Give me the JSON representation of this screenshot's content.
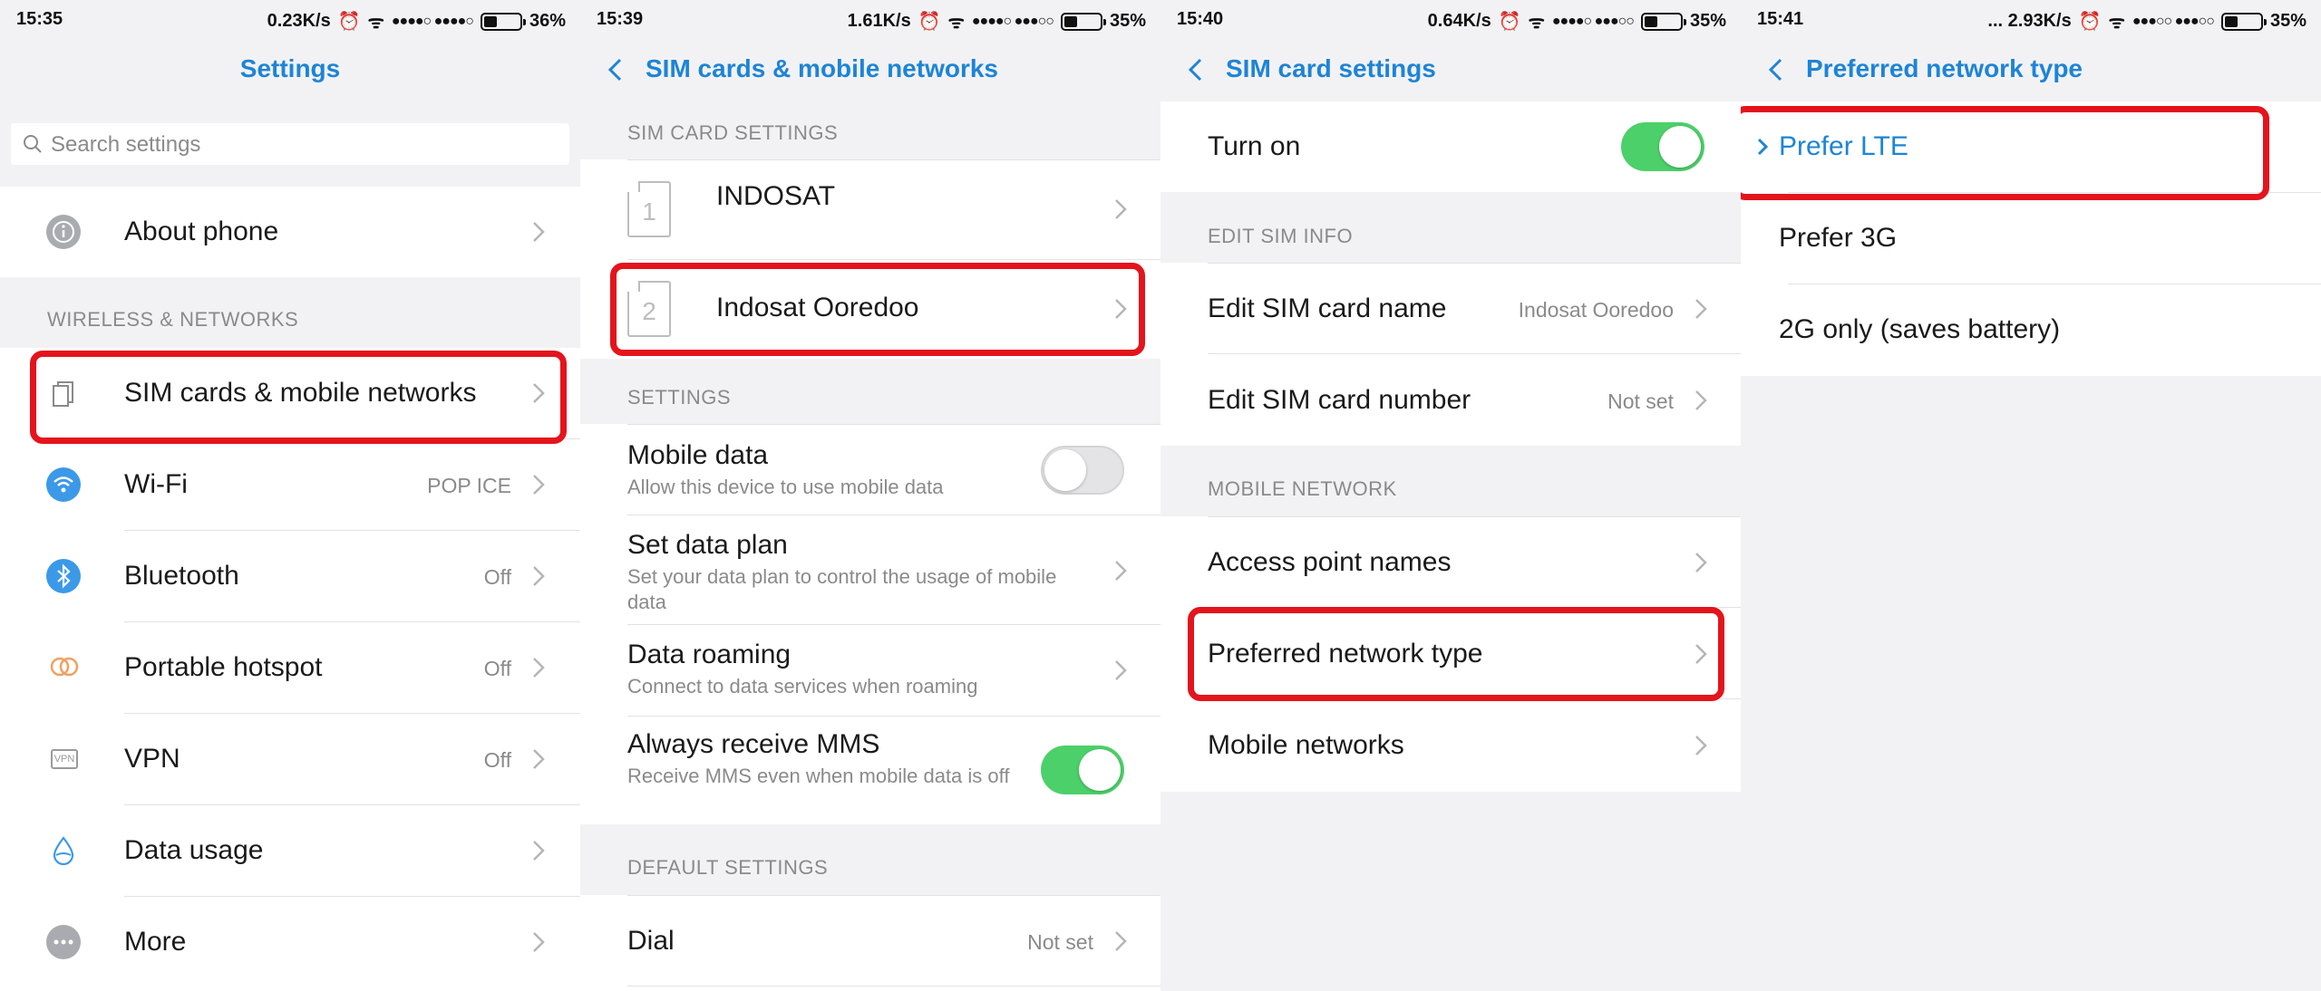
{
  "panel1": {
    "status": {
      "time": "15:35",
      "speed": "0.23K/s",
      "battery": "36%",
      "battery_level": 0.36
    },
    "title": "Settings",
    "search_placeholder": "Search settings",
    "about_label": "About phone",
    "section_wireless": "WIRELESS & NETWORKS",
    "items": [
      {
        "label": "SIM cards & mobile networks",
        "value": ""
      },
      {
        "label": "Wi-Fi",
        "value": "POP ICE"
      },
      {
        "label": "Bluetooth",
        "value": "Off"
      },
      {
        "label": "Portable hotspot",
        "value": "Off"
      },
      {
        "label": "VPN",
        "value": "Off"
      },
      {
        "label": "Data usage",
        "value": ""
      },
      {
        "label": "More",
        "value": ""
      }
    ],
    "vpn_icon_text": "VPN"
  },
  "panel2": {
    "status": {
      "time": "15:39",
      "speed": "1.61K/s",
      "battery": "35%",
      "battery_level": 0.35
    },
    "title": "SIM cards & mobile networks",
    "section_sim": "SIM CARD SETTINGS",
    "sim1": {
      "slot": "1",
      "name": "INDOSAT"
    },
    "sim2": {
      "slot": "2",
      "name": "Indosat Ooredoo"
    },
    "section_settings": "SETTINGS",
    "mobile_data": {
      "label": "Mobile data",
      "sub": "Allow this device to use mobile data",
      "on": false
    },
    "data_plan": {
      "label": "Set data plan",
      "sub": "Set your data plan to control the usage of mobile data"
    },
    "roaming": {
      "label": "Data roaming",
      "sub": "Connect to data services when roaming"
    },
    "mms": {
      "label": "Always receive MMS",
      "sub": "Receive MMS even when mobile data is off",
      "on": true
    },
    "section_default": "DEFAULT SETTINGS",
    "dial": {
      "label": "Dial",
      "value": "Not set"
    }
  },
  "panel3": {
    "status": {
      "time": "15:40",
      "speed": "0.64K/s",
      "battery": "35%",
      "battery_level": 0.35
    },
    "title": "SIM card settings",
    "turn_on": {
      "label": "Turn on",
      "on": true
    },
    "section_edit": "EDIT SIM INFO",
    "edit_name": {
      "label": "Edit SIM card name",
      "value": "Indosat Ooredoo"
    },
    "edit_number": {
      "label": "Edit SIM card number",
      "value": "Not set"
    },
    "section_mobile": "MOBILE NETWORK",
    "apn": {
      "label": "Access point names"
    },
    "preferred": {
      "label": "Preferred network type"
    },
    "mobile_networks": {
      "label": "Mobile networks"
    }
  },
  "panel4": {
    "status": {
      "time": "15:41",
      "speed": "... 2.93K/s",
      "battery": "35%",
      "battery_level": 0.35
    },
    "title": "Preferred network type",
    "options": [
      {
        "label": "Prefer LTE",
        "selected": true
      },
      {
        "label": "Prefer 3G",
        "selected": false
      },
      {
        "label": "2G only (saves battery)",
        "selected": false
      }
    ]
  },
  "colors": {
    "accent": "#1d84d6",
    "highlight": "#e4141c",
    "toggle_on": "#4cd06a",
    "background": "#f2f2f4"
  }
}
